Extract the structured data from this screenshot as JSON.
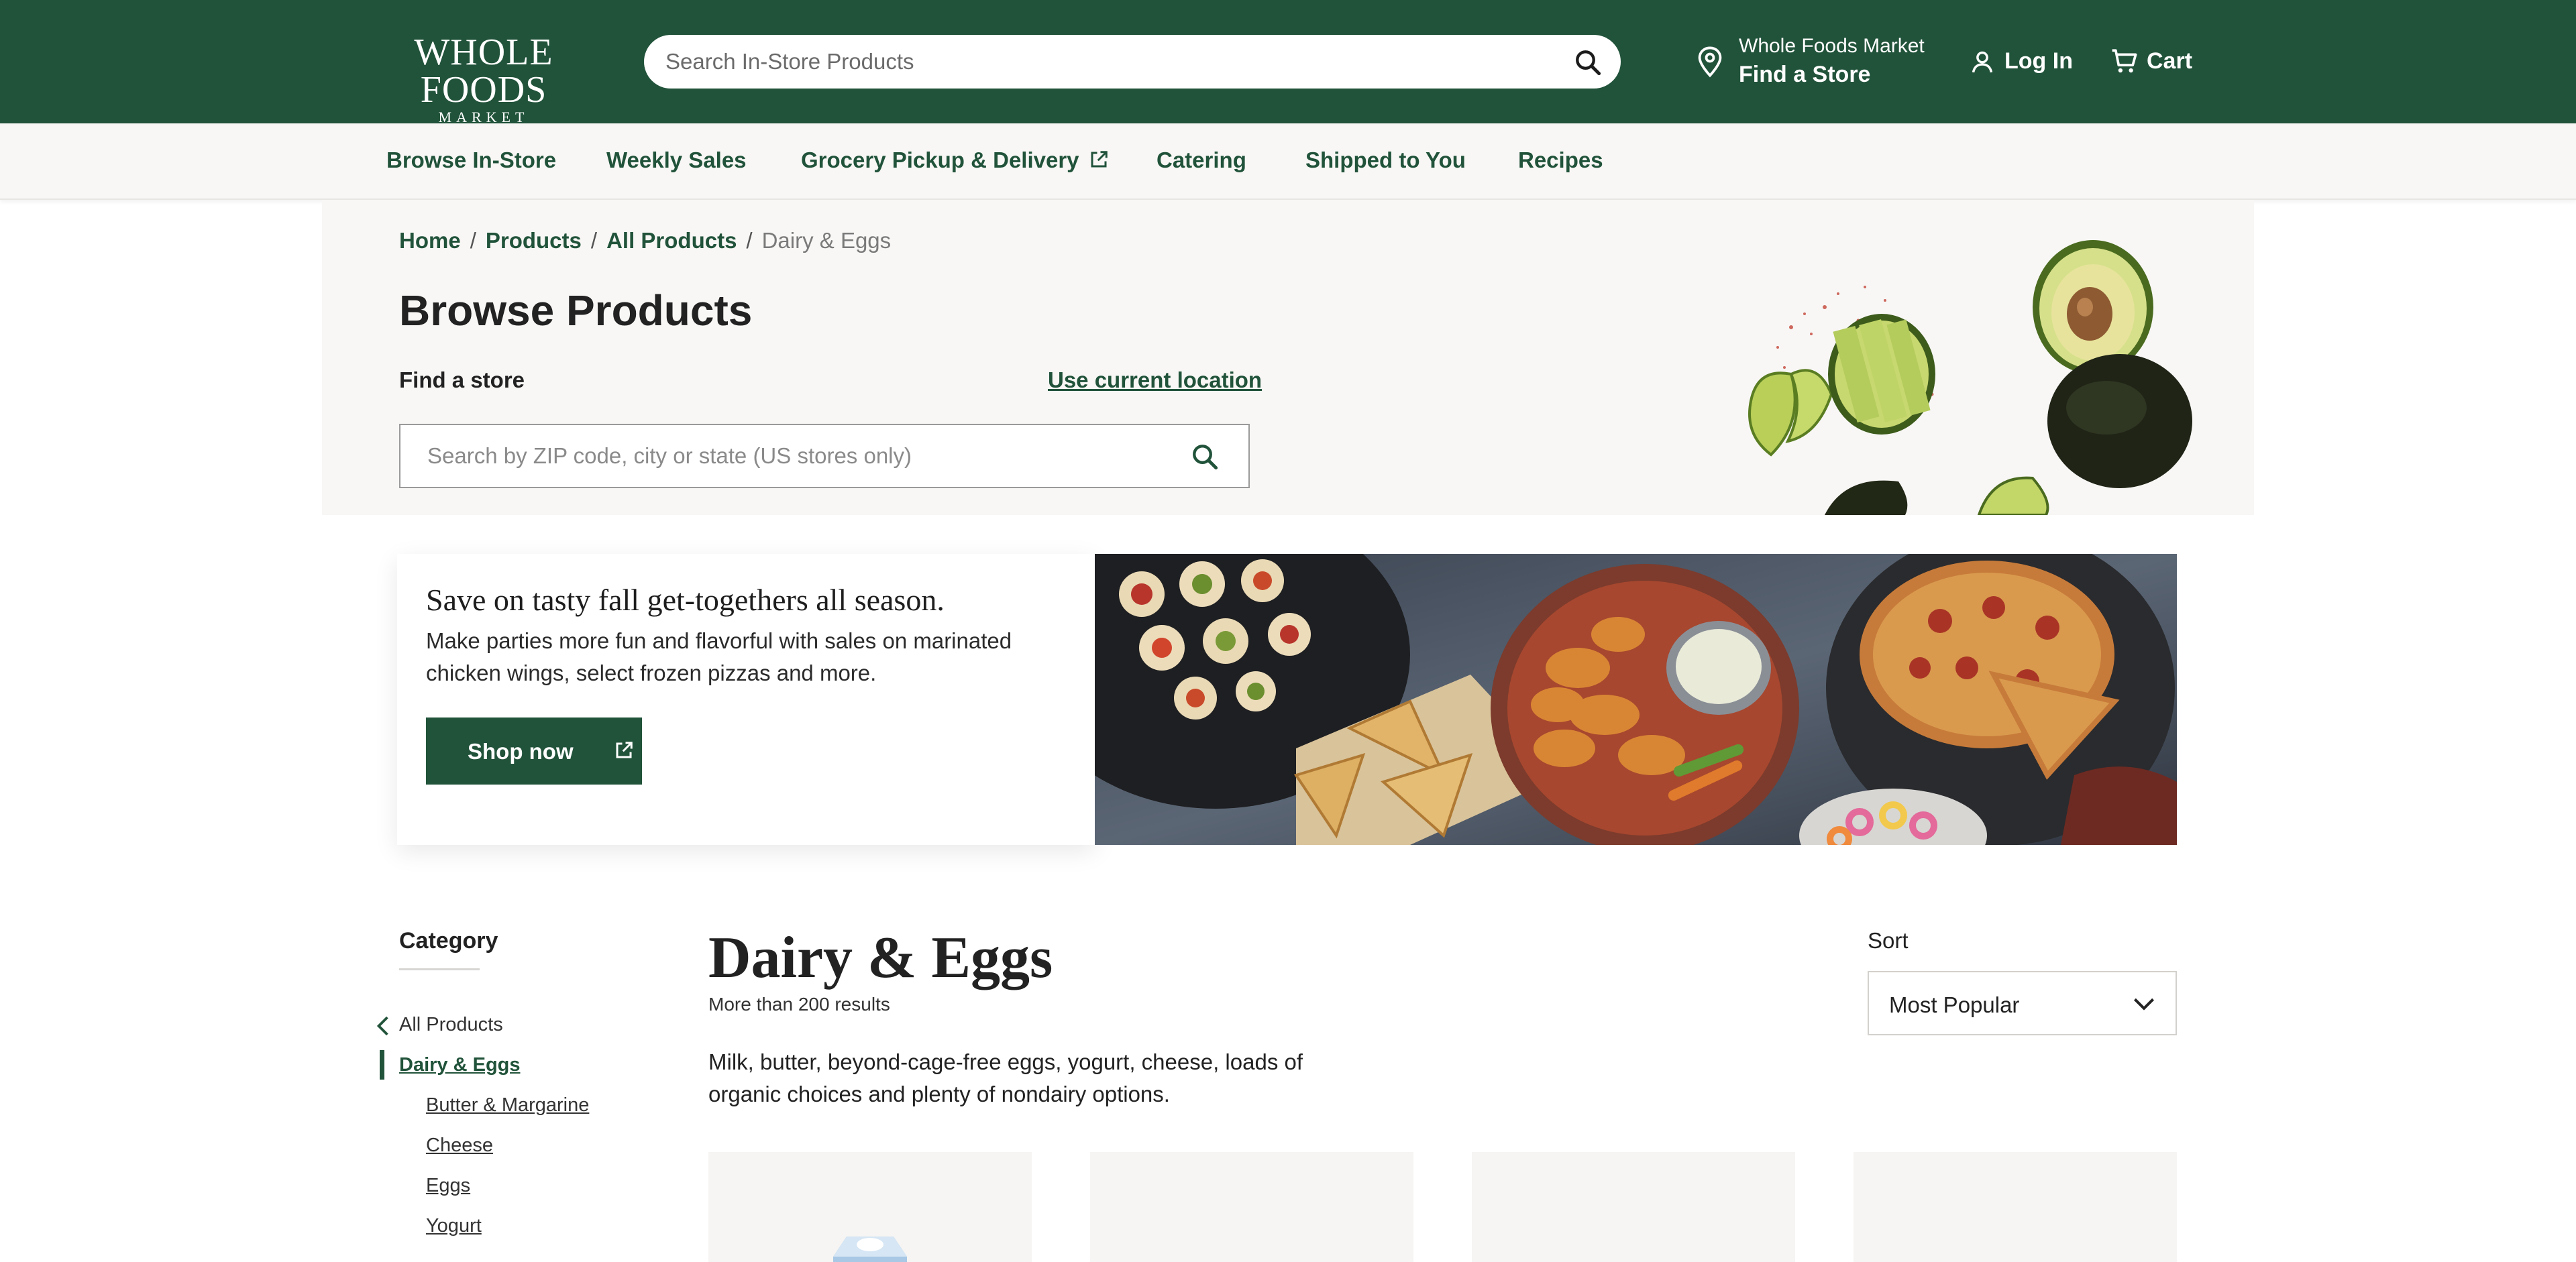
{
  "header": {
    "logo_line1": "WHOLE FOODS",
    "logo_line2": "MARKET",
    "search_placeholder": "Search In-Store Products",
    "store_label": "Whole Foods Market",
    "store_action": "Find a Store",
    "login_label": "Log In",
    "cart_label": "Cart",
    "brand_color": "#21533a"
  },
  "nav": {
    "items": [
      {
        "label": "Browse In-Store"
      },
      {
        "label": "Weekly Sales"
      },
      {
        "label": "Grocery Pickup & Delivery",
        "external": true
      },
      {
        "label": "Catering"
      },
      {
        "label": "Shipped to You"
      },
      {
        "label": "Recipes"
      }
    ]
  },
  "breadcrumb": {
    "items": [
      "Home",
      "Products",
      "All Products"
    ],
    "current": "Dairy & Eggs",
    "separator": "/"
  },
  "hero": {
    "title": "Browse Products",
    "find_store_label": "Find a store",
    "use_location_label": "Use current location",
    "zip_placeholder": "Search by ZIP code, city or state (US stores only)"
  },
  "promo": {
    "title": "Save on tasty fall get-togethers all season.",
    "text": "Make parties more fun and flavorful with sales on marinated chicken wings, select frozen pizzas and more.",
    "button_label": "Shop now"
  },
  "sidebar": {
    "title": "Category",
    "back_label": "All Products",
    "active_label": "Dairy & Eggs",
    "subcategories": [
      "Butter & Margarine",
      "Cheese",
      "Eggs",
      "Yogurt"
    ]
  },
  "listing": {
    "title": "Dairy & Eggs",
    "count": "More than 200 results",
    "description": "Milk, butter, beyond-cage-free eggs, yogurt, cheese, loads of organic choices and plenty of nondairy options.",
    "sort_label": "Sort",
    "sort_value": "Most Popular"
  }
}
